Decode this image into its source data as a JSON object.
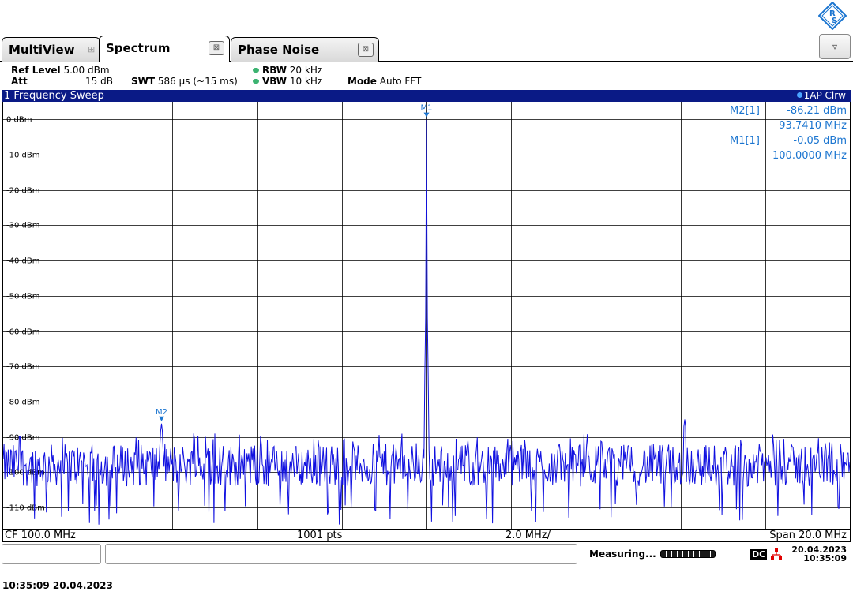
{
  "tabs": [
    {
      "label": "MultiView"
    },
    {
      "label": "Spectrum"
    },
    {
      "label": "Phase Noise"
    }
  ],
  "settings": {
    "ref_level_label": "Ref Level",
    "ref_level_value": "5.00 dBm",
    "att_label": "Att",
    "att_value": "15 dB",
    "swt_label": "SWT",
    "swt_value": "586 µs (~15 ms)",
    "rbw_label": "RBW",
    "rbw_value": "20 kHz",
    "vbw_label": "VBW",
    "vbw_value": "10 kHz",
    "mode_label": "Mode",
    "mode_value": "Auto FFT"
  },
  "window": {
    "title": "1 Frequency Sweep",
    "trace_info": "1AP Clrw"
  },
  "marker_table": [
    {
      "name": "M2[1]",
      "level": "-86.21 dBm",
      "freq": "93.7410 MHz"
    },
    {
      "name": "M1[1]",
      "level": "-0.05 dBm",
      "freq": "100.0000 MHz"
    }
  ],
  "chart_data": {
    "type": "line",
    "x_unit": "MHz",
    "xlim": [
      90.0,
      110.0
    ],
    "ylim": [
      -116,
      5
    ],
    "y_tick_labels": [
      "0 dBm",
      "-10 dBm",
      "-20 dBm",
      "-30 dBm",
      "-40 dBm",
      "-50 dBm",
      "-60 dBm",
      "-70 dBm",
      "-80 dBm",
      "-90 dBm",
      "-100 dBm",
      "-110 dBm"
    ],
    "y_ticks": [
      0,
      -10,
      -20,
      -30,
      -40,
      -50,
      -60,
      -70,
      -80,
      -90,
      -100,
      -110
    ],
    "grid": true,
    "trace_color": "#1010e0",
    "series": [
      {
        "noise_floor_dbm": -98,
        "noise_min_dbm": -115,
        "noise_max_dbm": -89,
        "peaks": [
          {
            "x": 100.0,
            "y": -0.05
          },
          {
            "x": 93.741,
            "y": -86.21
          },
          {
            "x": 106.1,
            "y": -85
          }
        ]
      }
    ],
    "markers": [
      {
        "label": "M1",
        "x": 100.0,
        "y": -0.05
      },
      {
        "label": "M2",
        "x": 93.741,
        "y": -86.21
      }
    ]
  },
  "footer": {
    "cf": "CF 100.0 MHz",
    "points": "1001 pts",
    "div": "2.0 MHz/",
    "span": "Span 20.0 MHz"
  },
  "status": {
    "measuring": "Measuring...",
    "dc": "DC",
    "date": "20.04.2023",
    "time": "10:35:09"
  },
  "stamp": "10:35:09  20.04.2023",
  "colors": {
    "accent": "#1b75d0",
    "title_bar": "#0a1a86",
    "trace": "#1010e0"
  }
}
